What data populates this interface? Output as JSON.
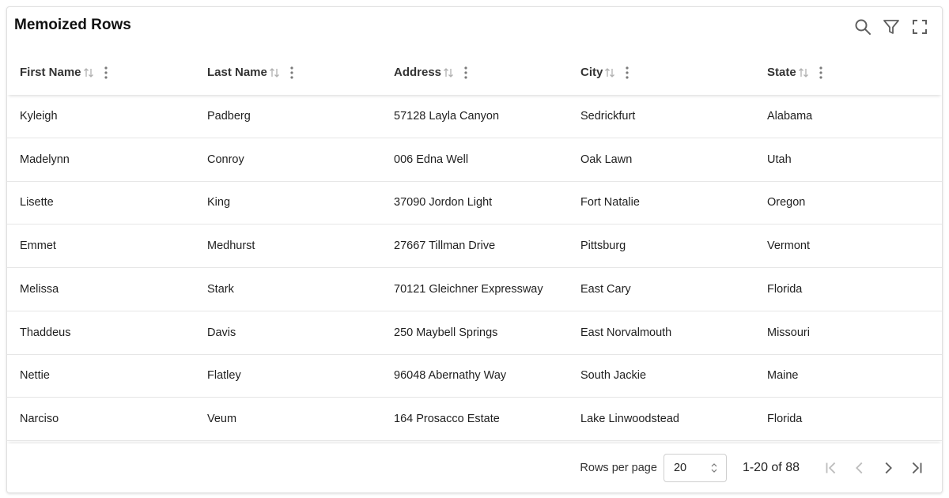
{
  "table": {
    "title": "Memoized Rows",
    "columns": [
      "First Name",
      "Last Name",
      "Address",
      "City",
      "State"
    ],
    "rows": [
      [
        "Kyleigh",
        "Padberg",
        "57128 Layla Canyon",
        "Sedrickfurt",
        "Alabama"
      ],
      [
        "Madelynn",
        "Conroy",
        "006 Edna Well",
        "Oak Lawn",
        "Utah"
      ],
      [
        "Lisette",
        "King",
        "37090 Jordon Light",
        "Fort Natalie",
        "Oregon"
      ],
      [
        "Emmet",
        "Medhurst",
        "27667 Tillman Drive",
        "Pittsburg",
        "Vermont"
      ],
      [
        "Melissa",
        "Stark",
        "70121 Gleichner Expressway",
        "East Cary",
        "Florida"
      ],
      [
        "Thaddeus",
        "Davis",
        "250 Maybell Springs",
        "East Norvalmouth",
        "Missouri"
      ],
      [
        "Nettie",
        "Flatley",
        "96048 Abernathy Way",
        "South Jackie",
        "Maine"
      ],
      [
        "Narciso",
        "Veum",
        "164 Prosacco Estate",
        "Lake Linwoodstead",
        "Florida"
      ]
    ]
  },
  "toolbar": {
    "icons": [
      "search-icon",
      "filter-icon",
      "fullscreen-icon"
    ]
  },
  "pagination": {
    "rows_per_page_label": "Rows per page",
    "rows_per_page_value": "20",
    "range": "1-20 of 88"
  },
  "colors": {
    "icon": "#5f5f5f",
    "icon_disabled": "#bdbdbd",
    "border": "#e6e6e6"
  }
}
